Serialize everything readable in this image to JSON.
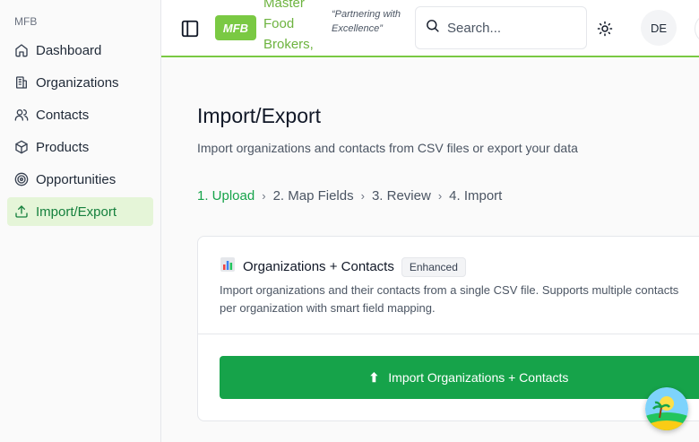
{
  "sidebar": {
    "group_label": "MFB",
    "items": [
      {
        "label": "Dashboard"
      },
      {
        "label": "Organizations"
      },
      {
        "label": "Contacts"
      },
      {
        "label": "Products"
      },
      {
        "label": "Opportunities"
      },
      {
        "label": "Import/Export"
      }
    ],
    "active_index": 5
  },
  "header": {
    "logo_text": "MFB",
    "brand": "Master Food Brokers, Inc.",
    "tagline": "“Partnering with Excellence”",
    "search_placeholder": "Search...",
    "avatar_initials": "DE"
  },
  "page": {
    "title": "Import/Export",
    "subtitle": "Import organizations and contacts from CSV files or export your data",
    "steps": [
      "1. Upload",
      "2. Map Fields",
      "3. Review",
      "4. Import"
    ],
    "active_step": 0
  },
  "card": {
    "title": "Organizations + Contacts",
    "badge": "Enhanced",
    "description": "Import organizations and their contacts from a single CSV file. Supports multiple contacts per organization with smart field mapping.",
    "button_label": "Import Organizations + Contacts"
  },
  "colors": {
    "brand_green": "#7ac943",
    "primary": "#16a34a",
    "active_bg": "#e5f5d8"
  }
}
